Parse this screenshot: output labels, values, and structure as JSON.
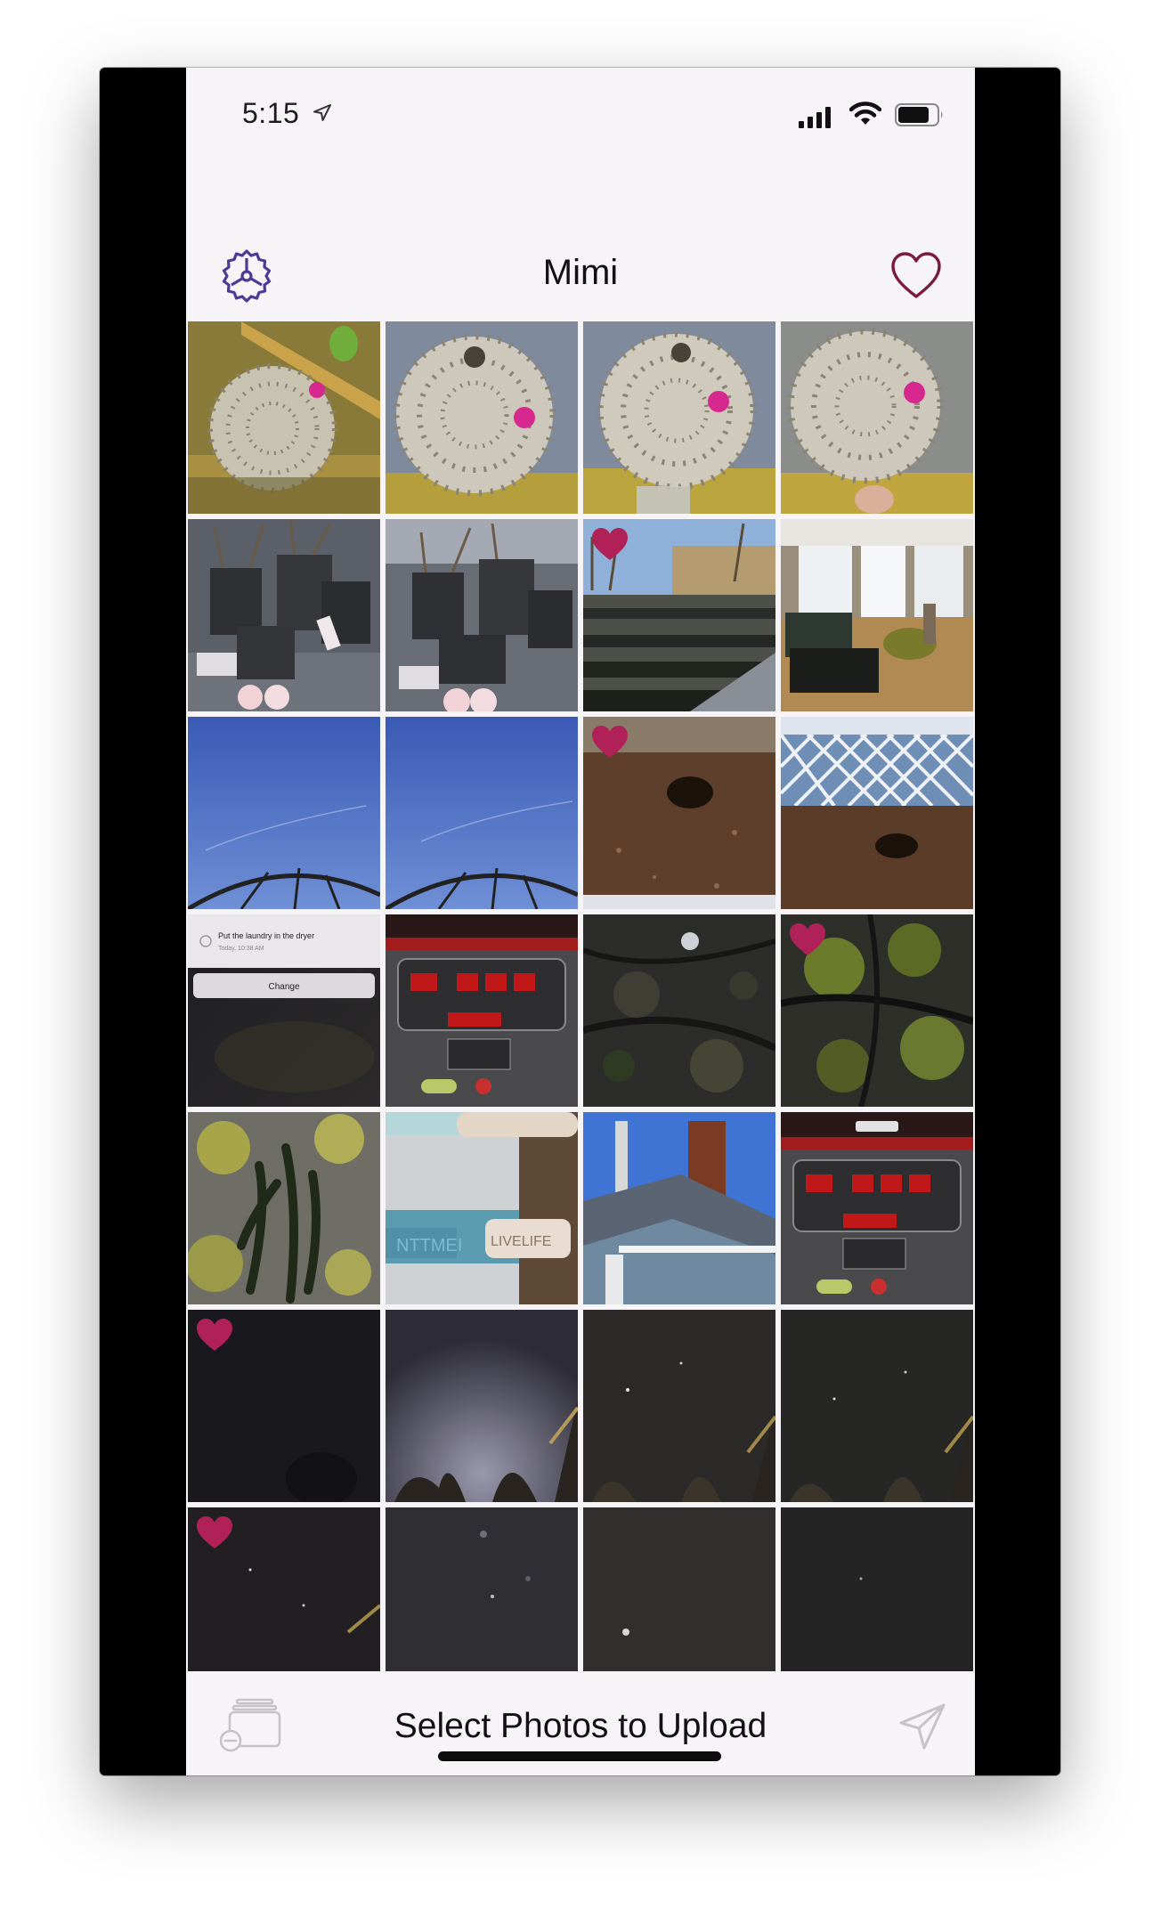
{
  "status_bar": {
    "time": "5:15",
    "icons": [
      "location-arrow-icon",
      "cellular-signal-icon",
      "wifi-icon",
      "battery-icon"
    ]
  },
  "nav_bar": {
    "title": "Mimi",
    "left_icon": "gear-icon",
    "right_icon": "heart-outline-icon"
  },
  "colors": {
    "accent": "#4c3a93",
    "heart": "#7a1b3e",
    "heart_badge": "#b02257",
    "background": "#f6f4f7"
  },
  "photos": [
    {
      "id": "cactus-1",
      "favorite": false
    },
    {
      "id": "cactus-2",
      "favorite": false
    },
    {
      "id": "cactus-3",
      "favorite": false
    },
    {
      "id": "cactus-4",
      "favorite": false
    },
    {
      "id": "pots-1",
      "favorite": false
    },
    {
      "id": "pots-2",
      "favorite": false
    },
    {
      "id": "nursery",
      "favorite": true
    },
    {
      "id": "living-room",
      "favorite": false
    },
    {
      "id": "sky-1",
      "favorite": false
    },
    {
      "id": "sky-2",
      "favorite": false
    },
    {
      "id": "dirt-hole-1",
      "favorite": true
    },
    {
      "id": "dirt-hole-2",
      "favorite": false
    },
    {
      "id": "reminder-screen",
      "favorite": false
    },
    {
      "id": "treadmill-1",
      "favorite": false
    },
    {
      "id": "bark-1",
      "favorite": false
    },
    {
      "id": "bark-2",
      "favorite": true
    },
    {
      "id": "moss",
      "favorite": false
    },
    {
      "id": "painted-pole",
      "favorite": false
    },
    {
      "id": "rooftop",
      "favorite": false
    },
    {
      "id": "treadmill-2",
      "favorite": false
    },
    {
      "id": "night-1",
      "favorite": true
    },
    {
      "id": "night-2",
      "favorite": false
    },
    {
      "id": "night-3",
      "favorite": false
    },
    {
      "id": "night-4",
      "favorite": false
    },
    {
      "id": "night-5",
      "favorite": true
    },
    {
      "id": "night-6",
      "favorite": false
    },
    {
      "id": "night-7",
      "favorite": false
    },
    {
      "id": "night-8",
      "favorite": false
    }
  ],
  "photo_text": {
    "reminder_task": "Put the laundry in the dryer",
    "reminder_time": "Today, 10:38 AM",
    "reminder_button": "Change",
    "pole_text_1": "LIVELIFE",
    "pole_text_2": "NTTMEI"
  },
  "toolbar": {
    "label": "Select Photos to Upload",
    "left_icon": "deselect-stack-icon",
    "right_icon": "send-icon"
  }
}
